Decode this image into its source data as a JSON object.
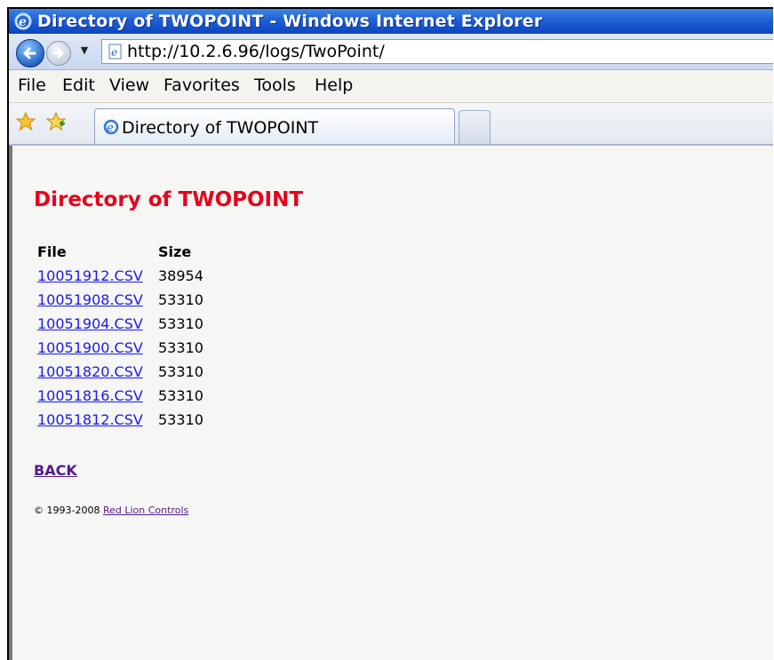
{
  "window": {
    "title": "Directory of TWOPOINT - Windows Internet Explorer"
  },
  "nav": {
    "address": "http://10.2.6.96/logs/TwoPoint/"
  },
  "menu": [
    "File",
    "Edit",
    "View",
    "Favorites",
    "Tools",
    "Help"
  ],
  "tab": {
    "label": "Directory of TWOPOINT"
  },
  "page": {
    "heading": "Directory of TWOPOINT",
    "columns": {
      "file": "File",
      "size": "Size"
    },
    "files": [
      {
        "name": "10051912.CSV",
        "size": "38954"
      },
      {
        "name": "10051908.CSV",
        "size": "53310"
      },
      {
        "name": "10051904.CSV",
        "size": "53310"
      },
      {
        "name": "10051900.CSV",
        "size": "53310"
      },
      {
        "name": "10051820.CSV",
        "size": "53310"
      },
      {
        "name": "10051816.CSV",
        "size": "53310"
      },
      {
        "name": "10051812.CSV",
        "size": "53310"
      }
    ],
    "back_label": "BACK",
    "footer_copyright": "© 1993-2008",
    "footer_link": "Red Lion Controls"
  },
  "colors": {
    "heading": "#e8001a",
    "link": "#1a1aee",
    "visited": "#551a8b",
    "titlebar": "#1f5fd6"
  },
  "icons": {
    "title": "ie-logo-icon",
    "back": "back-arrow-icon",
    "forward": "forward-arrow-icon",
    "page": "page-icon",
    "favorites": "favorites-star-icon",
    "add_favorite": "add-favorite-icon"
  }
}
